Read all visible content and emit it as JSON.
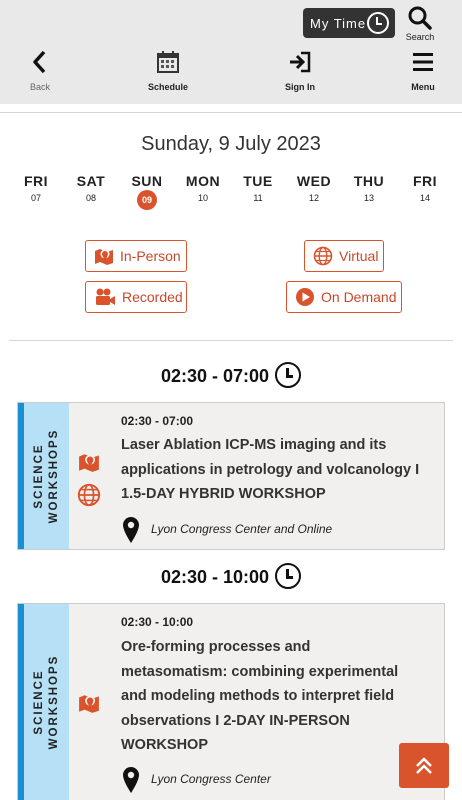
{
  "header": {
    "my_time_label": "My Time",
    "search_label": "Search",
    "nav": [
      {
        "label": "Back"
      },
      {
        "label": "Schedule"
      },
      {
        "label": "Sign In"
      },
      {
        "label": "Menu"
      }
    ]
  },
  "date_title": "Sunday, 9 July 2023",
  "days": [
    {
      "name": "FRI",
      "num": "07"
    },
    {
      "name": "SAT",
      "num": "08"
    },
    {
      "name": "SUN",
      "num": "09",
      "selected": true
    },
    {
      "name": "MON",
      "num": "10"
    },
    {
      "name": "TUE",
      "num": "11"
    },
    {
      "name": "WED",
      "num": "12"
    },
    {
      "name": "THU",
      "num": "13"
    },
    {
      "name": "FRI",
      "num": "14"
    }
  ],
  "filters": {
    "in_person": "In-Person",
    "virtual": "Virtual",
    "recorded": "Recorded",
    "on_demand": "On Demand"
  },
  "groups": [
    {
      "time_header": "02:30 - 07:00",
      "session": {
        "category": [
          "SCIENCE",
          "WORKSHOPS"
        ],
        "time": "02:30 - 07:00",
        "title_lines": [
          "Laser Ablation ICP-MS imaging and its",
          "applications in petrology and volcanology I",
          "1.5-DAY HYBRID WORKSHOP"
        ],
        "location": "Lyon Congress Center and Online"
      }
    },
    {
      "time_header": "02:30 - 10:00",
      "session": {
        "category": [
          "SCIENCE",
          "WORKSHOPS"
        ],
        "time": "02:30 - 10:00",
        "title_lines": [
          "Ore-forming processes and",
          "metasomatism: combining experimental",
          "and modeling methods to interpret field",
          "observations I 2-DAY IN-PERSON",
          "WORKSHOP"
        ],
        "location": "Lyon Congress Center"
      }
    }
  ],
  "colors": {
    "accent": "#d9542c",
    "category_band": "#b6e0f5",
    "category_stripe": "#1a8fd1",
    "header_bg": "#e9e9e9",
    "card_bg": "#f2f0ef"
  }
}
